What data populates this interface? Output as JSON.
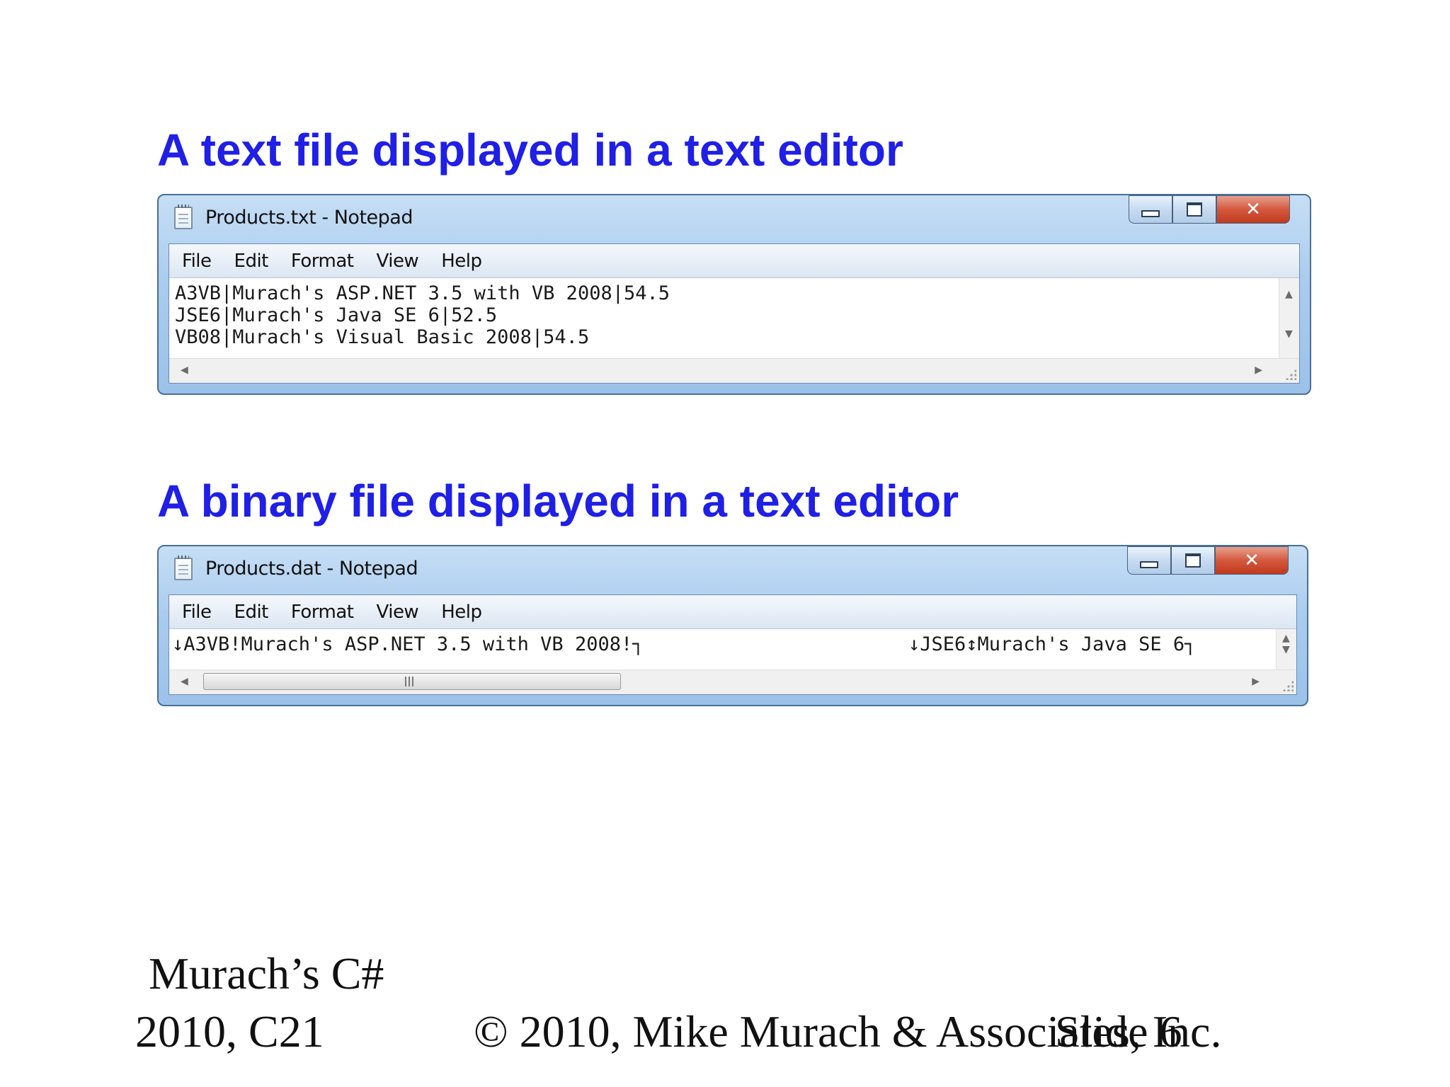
{
  "slide": {
    "heading_text_file": "A text file displayed in a text editor",
    "heading_binary_file": "A binary file displayed in a text editor",
    "footer_book": "Murach’s C#",
    "footer_chapter": "2010, C21",
    "footer_copyright": "© 2010, Mike Murach & Associates, Inc.",
    "footer_slide": "Slide 6"
  },
  "colors": {
    "heading": "#1f1fe6",
    "window_frame": "#a9cbee",
    "close_button": "#d4583d"
  },
  "window_text": {
    "title": "Products.txt - Notepad",
    "menu": [
      "File",
      "Edit",
      "Format",
      "View",
      "Help"
    ],
    "content_lines": [
      "A3VB|Murach's ASP.NET 3.5 with VB 2008|54.5",
      "JSE6|Murach's Java SE 6|52.5",
      "VB08|Murach's Visual Basic 2008|54.5"
    ],
    "controls": {
      "minimize": "minimize-icon",
      "maximize": "maximize-icon",
      "close": "✕"
    }
  },
  "window_binary": {
    "title": "Products.dat - Notepad",
    "menu": [
      "File",
      "Edit",
      "Format",
      "View",
      "Help"
    ],
    "content_line_left": "↓A3VB!Murach's ASP.NET 3.5 with VB 2008!┐",
    "content_line_right": "↓JSE6↕Murach's Java SE 6┐",
    "controls": {
      "minimize": "minimize-icon",
      "maximize": "maximize-icon",
      "close": "✕"
    }
  },
  "scroll_glyphs": {
    "up": "▲",
    "down": "▼",
    "left": "◀",
    "right": "▶"
  }
}
